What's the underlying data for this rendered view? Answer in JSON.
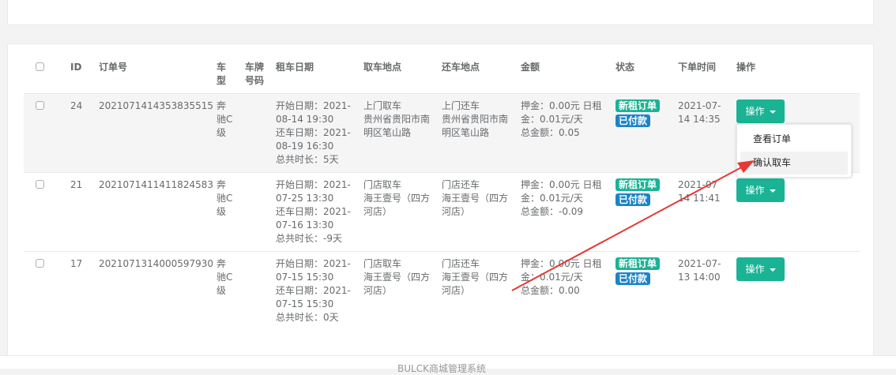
{
  "table": {
    "headers": {
      "id": "ID",
      "order_no": "订单号",
      "car_type": [
        "车",
        "型"
      ],
      "plate": [
        "车牌",
        "号码"
      ],
      "rent_date": "租车日期",
      "pickup": "取车地点",
      "return": "还车地点",
      "amount": "金额",
      "status": "状态",
      "order_time": "下单时间",
      "action": "操作"
    },
    "rows": [
      {
        "id": "24",
        "order_no": "2021071414353835515",
        "car": [
          "奔",
          "驰C",
          "级"
        ],
        "dates": [
          "开始日期：2021-",
          "08-14 19:30",
          "还车日期：2021-",
          "08-19 16:30",
          "总共时长：5天"
        ],
        "pickup": [
          "上门取车",
          "贵州省贵阳市南",
          "明区笔山路"
        ],
        "return": [
          "上门还车",
          "贵州省贵阳市南",
          "明区笔山路"
        ],
        "amount": [
          "押金：0.00元 日租",
          "金：0.01元/天",
          "总金额：0.05"
        ],
        "status": [
          "新租订单",
          "已付款"
        ],
        "time": [
          "2021-07-",
          "14 14:35"
        ],
        "action_label": "操作"
      },
      {
        "id": "21",
        "order_no": "2021071411411824583",
        "car": [
          "奔",
          "驰C",
          "级"
        ],
        "dates": [
          "开始日期：2021-",
          "07-25 13:30",
          "还车日期：2021-",
          "07-16 13:30",
          "总共时长：-9天"
        ],
        "pickup": [
          "门店取车",
          "海王壹号（四方",
          "河店）"
        ],
        "return": [
          "门店还车",
          "海王壹号（四方",
          "河店）"
        ],
        "amount": [
          "押金：0.00元 日租",
          "金：0.01元/天",
          "总金额：-0.09"
        ],
        "status": [
          "新租订单",
          "已付款"
        ],
        "time": [
          "2021-07",
          "14 11:41"
        ],
        "action_label": "操作"
      },
      {
        "id": "17",
        "order_no": "2021071314000597930",
        "car": [
          "奔",
          "驰C",
          "级"
        ],
        "dates": [
          "开始日期：2021-",
          "07-15 15:30",
          "还车日期：2021-",
          "07-15 15:30",
          "总共时长：0天"
        ],
        "pickup": [
          "门店取车",
          "海王壹号（四方",
          "河店）"
        ],
        "return": [
          "门店还车",
          "海王壹号（四方",
          "河店）"
        ],
        "amount": [
          "押金：0.00元 日租",
          "金：0.01元/天",
          "总金额：0.00"
        ],
        "status": [
          "新租订单",
          "已付款"
        ],
        "time": [
          "2021-07-",
          "13 14:00"
        ],
        "action_label": "操作"
      }
    ]
  },
  "dropdown": {
    "items": [
      "查看订单",
      "确认取车"
    ]
  },
  "footer": {
    "text": "BULCK商城管理系统"
  },
  "colors": {
    "primary": "#1ab394",
    "info": "#1c84c6",
    "annotation": "#e53935"
  }
}
